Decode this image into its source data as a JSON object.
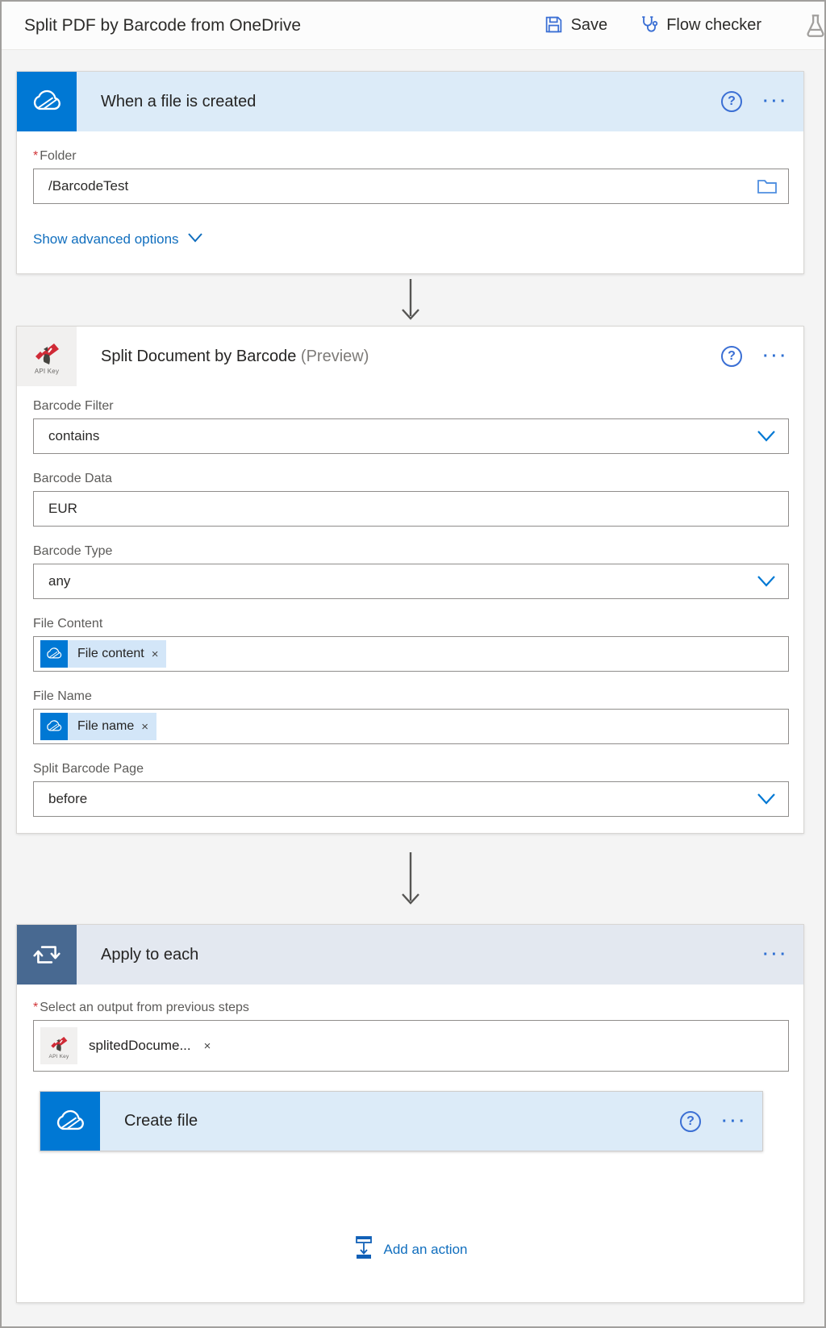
{
  "topbar": {
    "title": "Split PDF by Barcode from OneDrive",
    "save_label": "Save",
    "flow_checker_label": "Flow checker"
  },
  "icons": {
    "help": "?",
    "more": "···",
    "remove": "×",
    "asterisk": "*",
    "api_key_caption": "API Key"
  },
  "trigger": {
    "title": "When a file is created",
    "folder": {
      "label": "Folder",
      "value": "/BarcodeTest"
    },
    "advanced_label": "Show advanced options"
  },
  "split": {
    "title": "Split Document by Barcode",
    "preview_suffix": "(Preview)",
    "barcode_filter": {
      "label": "Barcode Filter",
      "value": "contains"
    },
    "barcode_data": {
      "label": "Barcode Data",
      "value": "EUR"
    },
    "barcode_type": {
      "label": "Barcode Type",
      "value": "any"
    },
    "file_content": {
      "label": "File Content",
      "token": "File content"
    },
    "file_name": {
      "label": "File Name",
      "token": "File name"
    },
    "split_barcode_page": {
      "label": "Split Barcode Page",
      "value": "before"
    }
  },
  "foreach": {
    "title": "Apply to each",
    "select_output": {
      "label": "Select an output from previous steps",
      "token": "splitedDocume..."
    },
    "create_file": {
      "title": "Create file"
    },
    "add_action_label": "Add an action"
  },
  "colors": {
    "onedrive_blue": "#0078d4",
    "control_slate": "#486991",
    "header_tint": "#dcebf8",
    "link_blue": "#106ebe",
    "required_red": "#d13438"
  }
}
